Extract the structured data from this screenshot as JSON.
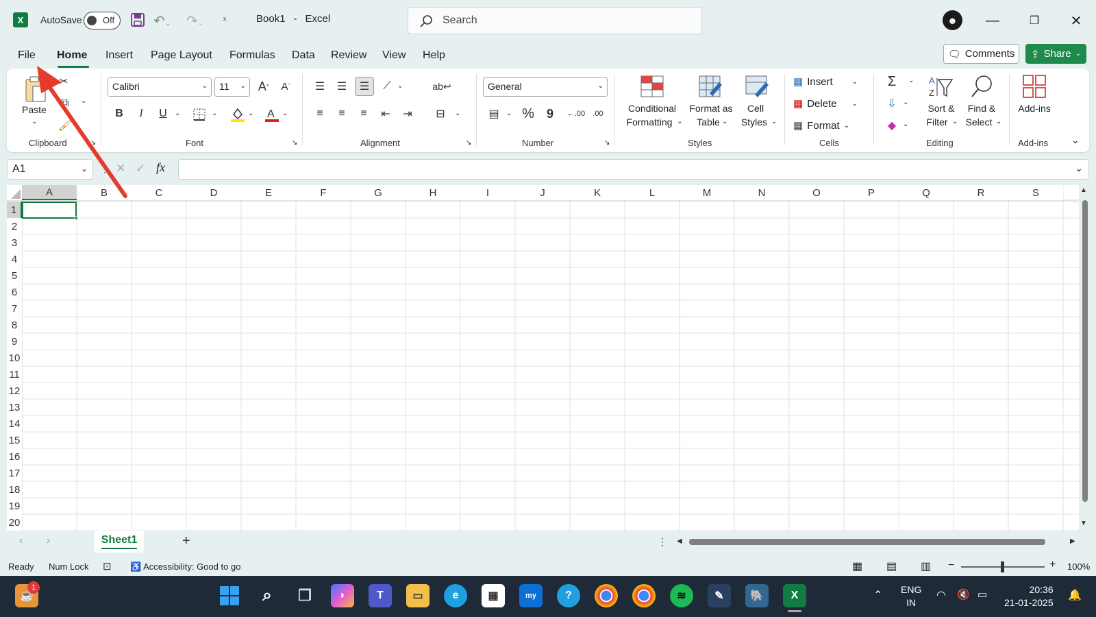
{
  "window": {
    "filename": "Book1",
    "separator": "-",
    "app": "Excel",
    "autosave_label": "AutoSave",
    "autosave_state": "Off"
  },
  "search": {
    "placeholder": "Search"
  },
  "tabs": [
    {
      "label": "File"
    },
    {
      "label": "Home"
    },
    {
      "label": "Insert"
    },
    {
      "label": "Page Layout"
    },
    {
      "label": "Formulas"
    },
    {
      "label": "Data"
    },
    {
      "label": "Review"
    },
    {
      "label": "View"
    },
    {
      "label": "Help"
    }
  ],
  "active_tab": "Home",
  "comments_label": "Comments",
  "share_label": "Share",
  "ribbon": {
    "clipboard": {
      "paste": "Paste",
      "group": "Clipboard"
    },
    "font": {
      "name": "Calibri",
      "size": "11",
      "group": "Font",
      "bold": "B",
      "italic": "I",
      "underline": "U",
      "grow": "A",
      "shrink": "A"
    },
    "alignment": {
      "group": "Alignment"
    },
    "number": {
      "format": "General",
      "group": "Number",
      "percent": "%",
      "comma": "9",
      "inc_decimal": "←.00",
      "dec_decimal": ".00"
    },
    "styles": {
      "conditional_1": "Conditional",
      "conditional_2": "Formatting",
      "format_table_1": "Format as",
      "format_table_2": "Table",
      "cell_styles_1": "Cell",
      "cell_styles_2": "Styles",
      "group": "Styles"
    },
    "cells": {
      "insert": "Insert",
      "delete": "Delete",
      "format": "Format",
      "group": "Cells"
    },
    "editing": {
      "sum": "Σ",
      "sort_1": "Sort &",
      "sort_2": "Filter",
      "find_1": "Find &",
      "find_2": "Select",
      "group": "Editing"
    },
    "addins": {
      "label": "Add-ins",
      "group": "Add-ins"
    }
  },
  "formula_bar": {
    "name_box": "A1",
    "fx": "fx",
    "value": ""
  },
  "columns": [
    "A",
    "B",
    "C",
    "D",
    "E",
    "F",
    "G",
    "H",
    "I",
    "J",
    "K",
    "L",
    "M",
    "N",
    "O",
    "P",
    "Q",
    "R",
    "S"
  ],
  "rows": [
    "1",
    "2",
    "3",
    "4",
    "5",
    "6",
    "7",
    "8",
    "9",
    "10",
    "11",
    "12",
    "13",
    "14",
    "15",
    "16",
    "17",
    "18",
    "19",
    "20"
  ],
  "selected_cell": "A1",
  "sheets": [
    {
      "name": "Sheet1"
    }
  ],
  "status": {
    "ready": "Ready",
    "numlock": "Num Lock",
    "accessibility": "Accessibility: Good to go",
    "zoom": "100%"
  },
  "taskbar": {
    "lang_1": "ENG",
    "lang_2": "IN",
    "time": "20:36",
    "date": "21-01-2025",
    "notif_badge": "1"
  },
  "colors": {
    "accent_green": "#107c41",
    "share_green": "#1f8a4c",
    "arrow_red": "#e43b2c",
    "taskbar": "#1f2a39"
  }
}
